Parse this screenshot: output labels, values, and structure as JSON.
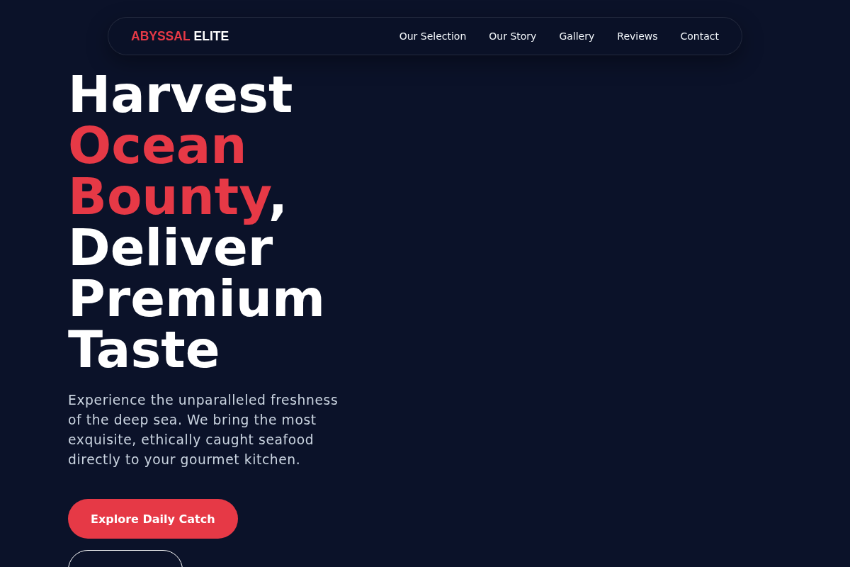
{
  "nav": {
    "logo": {
      "primary": "ABYSSAL",
      "secondary": "ELITE"
    },
    "links": [
      {
        "label": "Our Selection"
      },
      {
        "label": "Our Story"
      },
      {
        "label": "Gallery"
      },
      {
        "label": "Reviews"
      },
      {
        "label": "Contact"
      }
    ]
  },
  "hero": {
    "heading": [
      {
        "text": "Harvest ",
        "accent": false
      },
      {
        "text": "Ocean Bounty",
        "accent": true
      },
      {
        "text": ", Deliver Premium Taste",
        "accent": false
      }
    ],
    "paragraph": "Experience the unparalleled freshness of the deep sea. We bring the most exquisite, ethically caught seafood directly to your gourmet kitchen.",
    "buttons": [
      {
        "kind": "primary",
        "label": "Explore Daily Catch"
      },
      {
        "kind": "outline"
      }
    ]
  }
}
